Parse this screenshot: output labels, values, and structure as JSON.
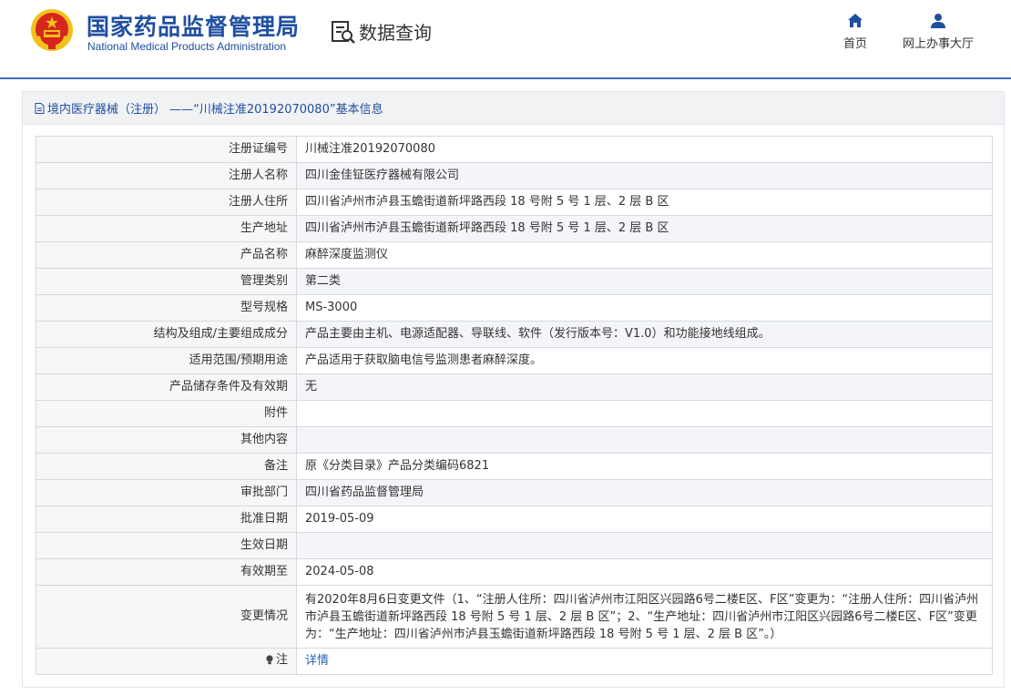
{
  "header": {
    "brand_cn": "国家药品监督管理局",
    "brand_en": "National Medical Products Administration",
    "data_query": "数据查询",
    "nav": [
      {
        "label": "首页",
        "icon": "home-icon"
      },
      {
        "label": "网上办事大厅",
        "icon": "user-icon"
      }
    ]
  },
  "panel": {
    "title": "境内医疗器械（注册） ——“川械注准20192070080”基本信息",
    "rows": [
      {
        "key": "注册证编号",
        "value": "川械注准20192070080"
      },
      {
        "key": "注册人名称",
        "value": "四川金佳钲医疗器械有限公司"
      },
      {
        "key": "注册人住所",
        "value": "四川省泸州市泸县玉蟾街道新坪路西段 18 号附 5 号 1 层、2 层 B 区"
      },
      {
        "key": "生产地址",
        "value": "四川省泸州市泸县玉蟾街道新坪路西段 18 号附 5 号 1 层、2 层 B 区"
      },
      {
        "key": "产品名称",
        "value": "麻醉深度监测仪"
      },
      {
        "key": "管理类别",
        "value": "第二类"
      },
      {
        "key": "型号规格",
        "value": "MS-3000"
      },
      {
        "key": "结构及组成/主要组成成分",
        "value": "产品主要由主机、电源适配器、导联线、软件（发行版本号：V1.0）和功能接地线组成。"
      },
      {
        "key": "适用范围/预期用途",
        "value": "产品适用于获取脑电信号监测患者麻醉深度。"
      },
      {
        "key": "产品储存条件及有效期",
        "value": "无"
      },
      {
        "key": "附件",
        "value": ""
      },
      {
        "key": "其他内容",
        "value": ""
      },
      {
        "key": "备注",
        "value": "原《分类目录》产品分类编码6821"
      },
      {
        "key": "审批部门",
        "value": "四川省药品监督管理局"
      },
      {
        "key": "批准日期",
        "value": "2019-05-09"
      },
      {
        "key": "生效日期",
        "value": ""
      },
      {
        "key": "有效期至",
        "value": "2024-05-08"
      },
      {
        "key": "变更情况",
        "value": "有2020年8月6日变更文件（1、“注册人住所：四川省泸州市江阳区兴园路6号二楼E区、F区”变更为：“注册人住所：四川省泸州市泸县玉蟾街道新坪路西段 18 号附 5 号 1 层、2 层 B 区”；2、“生产地址：四川省泸州市江阳区兴园路6号二楼E区、F区”变更为：“生产地址：四川省泸州市泸县玉蟾街道新坪路西段 18 号附 5 号 1 层、2 层 B 区”。）"
      }
    ],
    "note_row": {
      "key": "注",
      "value": "详情",
      "icon": "lightbulb-icon"
    }
  },
  "colors": {
    "brand": "#1f4fa0",
    "link": "#2a64b8",
    "emblem_red": "#d7261f",
    "emblem_gold": "#f2c21a"
  }
}
